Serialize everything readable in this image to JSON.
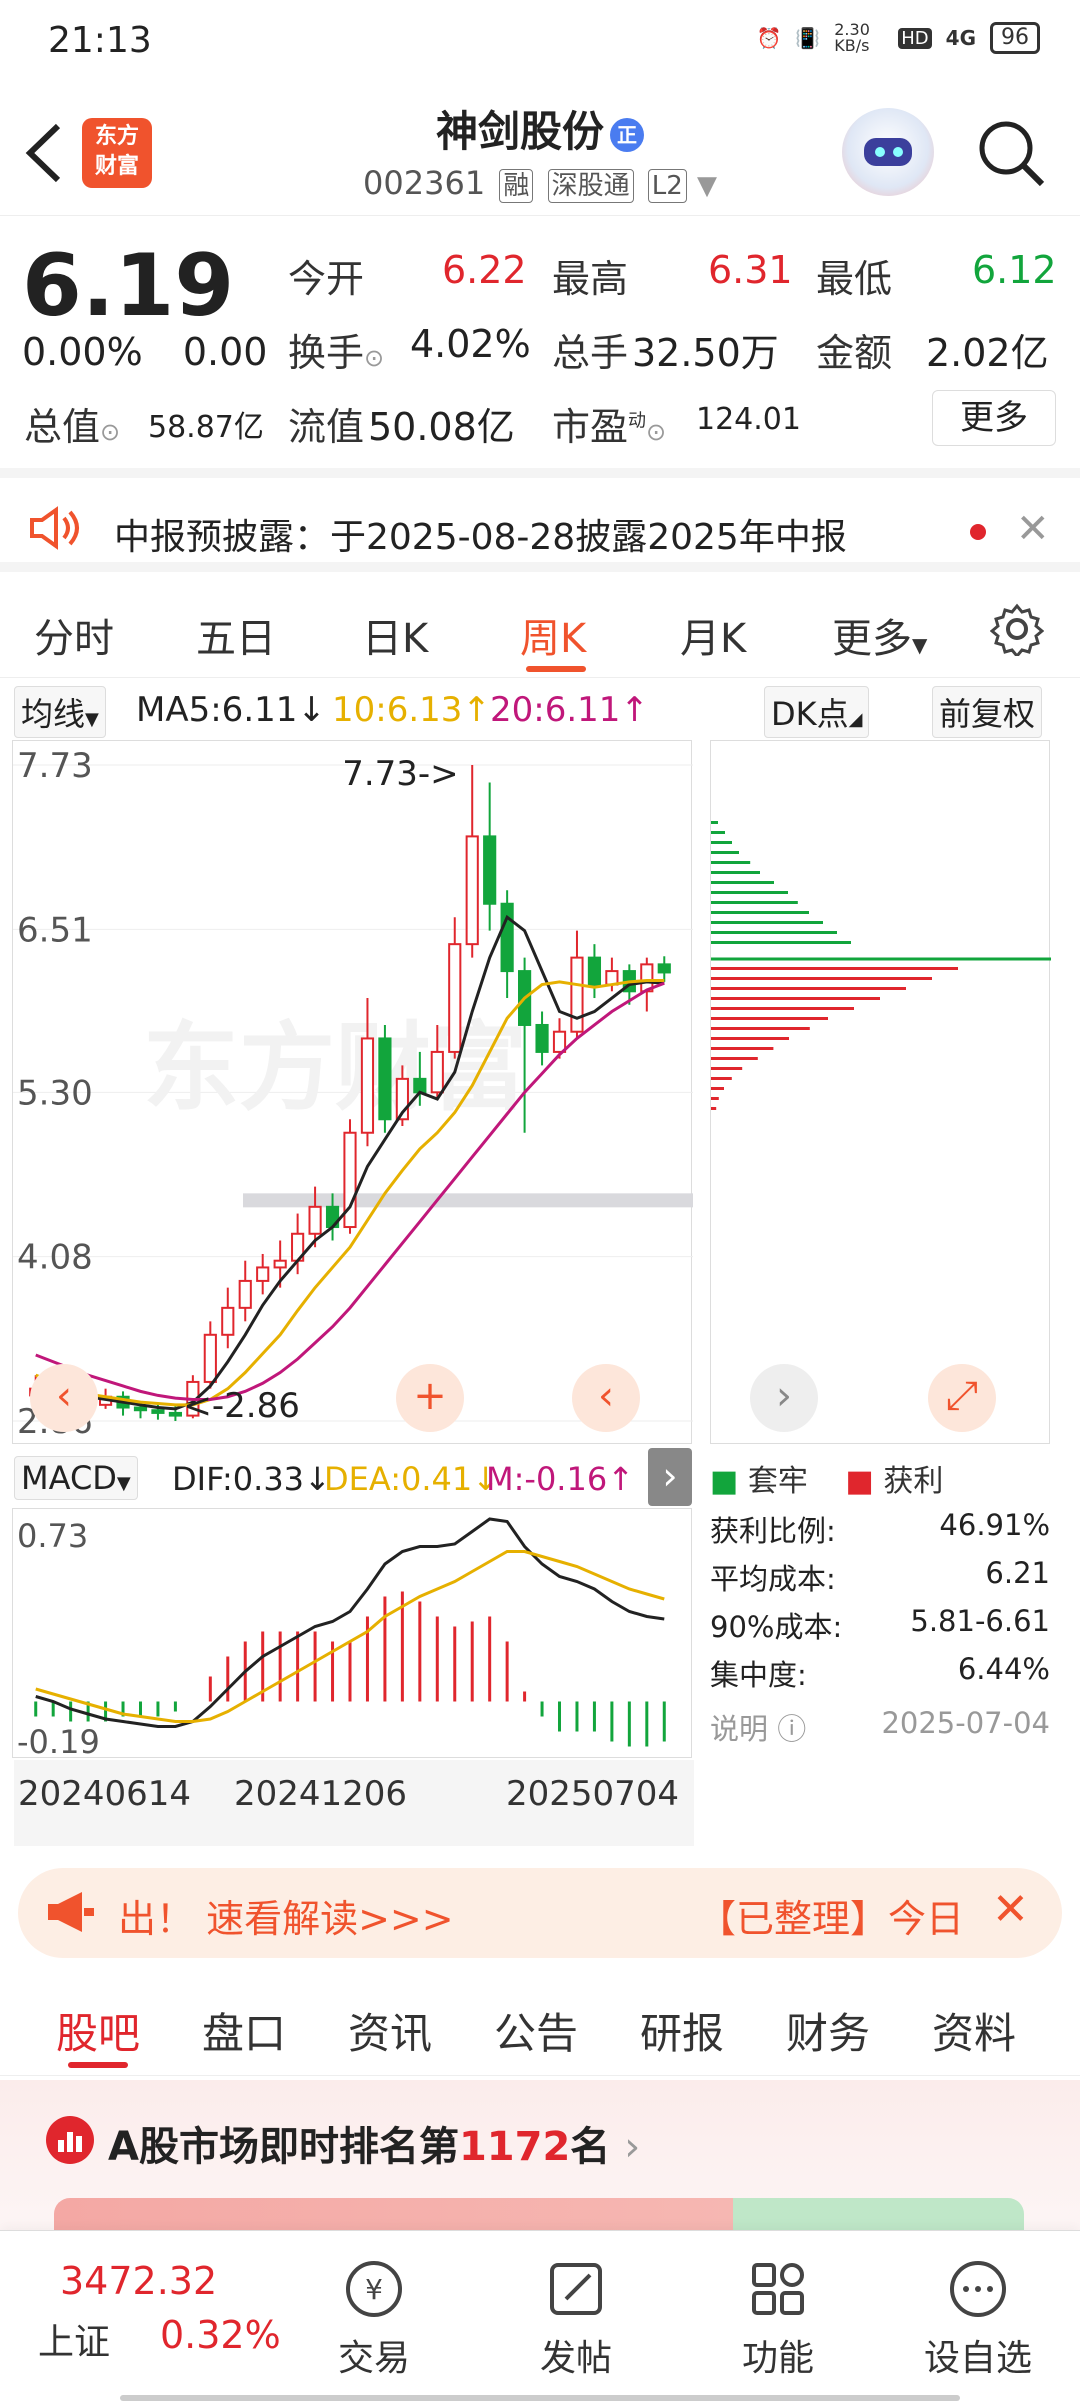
{
  "status_bar": {
    "time": "21:13",
    "net_speed": "2.30 KB/s",
    "hd": "HD",
    "signal": "4G",
    "battery": "96"
  },
  "header": {
    "logo_line1": "东方",
    "logo_line2": "财富",
    "stock_name": "神剑股份",
    "stock_code": "002361",
    "tags": [
      "融",
      "深股通",
      "L2"
    ],
    "badge": "正"
  },
  "quote": {
    "price": "6.19",
    "change_pct": "0.00%",
    "change_amt": "0.00",
    "open_label": "今开",
    "open": "6.22",
    "high_label": "最高",
    "high": "6.31",
    "low_label": "最低",
    "low": "6.12",
    "turnover_label": "换手",
    "turnover": "4.02%",
    "volume_label": "总手",
    "volume": "32.50万",
    "amount_label": "金额",
    "amount": "2.02亿",
    "mcap_label": "总值",
    "mcap": "58.87亿",
    "float_label": "流值",
    "float_mcap": "50.08亿",
    "pe_label": "市盈",
    "pe_sup": "动",
    "pe": "124.01",
    "more_label": "更多"
  },
  "notice": {
    "text": "中报预披露：于2025-08-28披露2025年中报"
  },
  "period_tabs": [
    "分时",
    "五日",
    "日K",
    "周K",
    "月K",
    "更多"
  ],
  "period_active": "周K",
  "indicators": {
    "ma_select": "均线",
    "ma5": "MA5:6.11↓",
    "ma10": "10:6.13↑",
    "ma20": "20:6.11↑",
    "dk": "DK点",
    "adjust": "前复权",
    "macd_select": "MACD",
    "dif": "DIF:0.33↓",
    "dea": "DEA:0.41↓",
    "m": "M:-0.16↑"
  },
  "kline": {
    "y_labels": [
      "7.73",
      "6.51",
      "5.30",
      "4.08",
      "2.86"
    ],
    "high_annot": "7.73->",
    "low_annot": "<-2.86",
    "watermark": "东方财富"
  },
  "macd_axis": {
    "top": "0.73",
    "bottom": "-0.19",
    "dates": [
      "20240614",
      "20241206",
      "20250704"
    ]
  },
  "chip_dist": {
    "legend_locked": "套牢",
    "legend_profit": "获利",
    "rows": [
      {
        "label": "获利比例:",
        "value": "46.91%"
      },
      {
        "label": "平均成本:",
        "value": "6.21"
      },
      {
        "label": "90%成本:",
        "value": "5.81-6.61"
      },
      {
        "label": "集中度:",
        "value": "6.44%"
      }
    ],
    "note_label": "说明",
    "date": "2025-07-04"
  },
  "banner": {
    "text1": "出！  速看解读>>>",
    "text2": "【已整理】今日"
  },
  "bottom_tabs": [
    "股吧",
    "盘口",
    "资讯",
    "公告",
    "研报",
    "财务",
    "资料"
  ],
  "bottom_tab_active": "股吧",
  "rank": {
    "prefix": "A股市场即时排名第",
    "number": "1172",
    "suffix": "名"
  },
  "bottom_bar": {
    "index_value": "3472.32",
    "index_name": "上证",
    "index_change": "0.32%",
    "items": [
      "交易",
      "发帖",
      "功能",
      "设自选"
    ]
  },
  "chart_data": {
    "type": "candlestick",
    "title": "",
    "ylim": [
      2.86,
      7.73
    ],
    "candles": [
      [
        3.05,
        3.1,
        2.95,
        3.2
      ],
      [
        3.1,
        3.02,
        2.98,
        3.15
      ],
      [
        3.02,
        3.0,
        2.93,
        3.08
      ],
      [
        3.0,
        2.98,
        2.92,
        3.05
      ],
      [
        2.98,
        3.04,
        2.95,
        3.1
      ],
      [
        3.04,
        2.96,
        2.9,
        3.08
      ],
      [
        2.96,
        2.94,
        2.88,
        3.0
      ],
      [
        2.94,
        2.92,
        2.87,
        2.98
      ],
      [
        2.92,
        2.9,
        2.86,
        2.97
      ],
      [
        2.9,
        3.15,
        2.88,
        3.2
      ],
      [
        3.15,
        3.5,
        3.1,
        3.6
      ],
      [
        3.5,
        3.7,
        3.4,
        3.85
      ],
      [
        3.7,
        3.9,
        3.6,
        4.05
      ],
      [
        3.9,
        4.0,
        3.8,
        4.1
      ],
      [
        4.0,
        4.05,
        3.85,
        4.2
      ],
      [
        4.05,
        4.25,
        3.95,
        4.4
      ],
      [
        4.25,
        4.45,
        4.15,
        4.6
      ],
      [
        4.45,
        4.3,
        4.2,
        4.55
      ],
      [
        4.3,
        5.0,
        4.25,
        5.1
      ],
      [
        5.0,
        5.7,
        4.9,
        6.0
      ],
      [
        5.7,
        5.1,
        5.0,
        5.8
      ],
      [
        5.1,
        5.4,
        5.05,
        5.5
      ],
      [
        5.4,
        5.3,
        5.2,
        5.6
      ],
      [
        5.3,
        5.6,
        5.25,
        5.8
      ],
      [
        5.6,
        6.4,
        5.55,
        6.6
      ],
      [
        6.4,
        7.2,
        6.3,
        7.73
      ],
      [
        7.2,
        6.7,
        6.5,
        7.6
      ],
      [
        6.7,
        6.2,
        6.0,
        6.8
      ],
      [
        6.2,
        5.8,
        5.0,
        6.3
      ],
      [
        5.8,
        5.6,
        5.5,
        5.9
      ],
      [
        5.6,
        5.75,
        5.55,
        5.85
      ],
      [
        5.75,
        6.3,
        5.7,
        6.5
      ],
      [
        6.3,
        6.1,
        6.0,
        6.4
      ],
      [
        6.1,
        6.2,
        6.05,
        6.3
      ],
      [
        6.2,
        6.05,
        5.95,
        6.25
      ],
      [
        6.05,
        6.25,
        5.9,
        6.3
      ],
      [
        6.25,
        6.19,
        6.12,
        6.31
      ]
    ],
    "ma5": [
      3.1,
      3.08,
      3.06,
      3.04,
      3.02,
      3.0,
      2.98,
      2.96,
      2.95,
      3.0,
      3.12,
      3.3,
      3.5,
      3.72,
      3.9,
      4.05,
      4.2,
      4.3,
      4.45,
      4.75,
      4.95,
      5.15,
      5.3,
      5.25,
      5.45,
      5.9,
      6.3,
      6.6,
      6.5,
      6.2,
      5.9,
      5.85,
      5.9,
      6.0,
      6.1,
      6.12,
      6.11
    ],
    "ma10": [
      3.2,
      3.15,
      3.1,
      3.06,
      3.04,
      3.02,
      3.0,
      2.99,
      2.98,
      2.98,
      3.02,
      3.1,
      3.22,
      3.36,
      3.5,
      3.68,
      3.85,
      4.0,
      4.15,
      4.35,
      4.55,
      4.72,
      4.88,
      5.0,
      5.15,
      5.35,
      5.6,
      5.85,
      6.0,
      6.1,
      6.12,
      6.1,
      6.08,
      6.1,
      6.12,
      6.13,
      6.13
    ],
    "ma20": [
      3.35,
      3.3,
      3.25,
      3.2,
      3.16,
      3.12,
      3.08,
      3.05,
      3.03,
      3.02,
      3.02,
      3.04,
      3.08,
      3.14,
      3.22,
      3.32,
      3.44,
      3.56,
      3.7,
      3.86,
      4.02,
      4.18,
      4.34,
      4.5,
      4.66,
      4.82,
      4.98,
      5.14,
      5.3,
      5.44,
      5.58,
      5.7,
      5.8,
      5.9,
      5.98,
      6.06,
      6.11
    ],
    "macd": {
      "dif": [
        0.02,
        0.0,
        -0.03,
        -0.05,
        -0.07,
        -0.08,
        -0.09,
        -0.1,
        -0.1,
        -0.08,
        -0.02,
        0.05,
        0.12,
        0.18,
        0.22,
        0.26,
        0.3,
        0.32,
        0.36,
        0.45,
        0.55,
        0.6,
        0.62,
        0.62,
        0.63,
        0.68,
        0.73,
        0.72,
        0.62,
        0.55,
        0.5,
        0.48,
        0.45,
        0.4,
        0.36,
        0.34,
        0.33
      ],
      "dea": [
        0.05,
        0.03,
        0.01,
        -0.01,
        -0.03,
        -0.05,
        -0.06,
        -0.07,
        -0.08,
        -0.08,
        -0.07,
        -0.04,
        0.0,
        0.04,
        0.08,
        0.12,
        0.16,
        0.2,
        0.24,
        0.28,
        0.34,
        0.38,
        0.42,
        0.45,
        0.48,
        0.52,
        0.56,
        0.6,
        0.6,
        0.58,
        0.56,
        0.54,
        0.51,
        0.48,
        0.45,
        0.43,
        0.41
      ],
      "m": [
        -0.06,
        -0.06,
        -0.08,
        -0.08,
        -0.08,
        -0.06,
        -0.06,
        -0.06,
        -0.04,
        0.0,
        0.1,
        0.18,
        0.24,
        0.28,
        0.28,
        0.28,
        0.28,
        0.24,
        0.24,
        0.34,
        0.42,
        0.44,
        0.4,
        0.34,
        0.3,
        0.32,
        0.34,
        0.24,
        0.04,
        -0.06,
        -0.12,
        -0.12,
        -0.12,
        -0.16,
        -0.18,
        -0.18,
        -0.16
      ]
    },
    "chips_locked": [
      0.05,
      0.1,
      0.15,
      0.2,
      0.28,
      0.35,
      0.45,
      0.55,
      0.62,
      0.7,
      0.8,
      0.9,
      1.0
    ],
    "chips_profit": [
      0.95,
      0.85,
      0.75,
      0.65,
      0.55,
      0.45,
      0.38,
      0.3,
      0.24,
      0.18,
      0.12,
      0.08,
      0.05,
      0.03,
      0.02
    ]
  }
}
